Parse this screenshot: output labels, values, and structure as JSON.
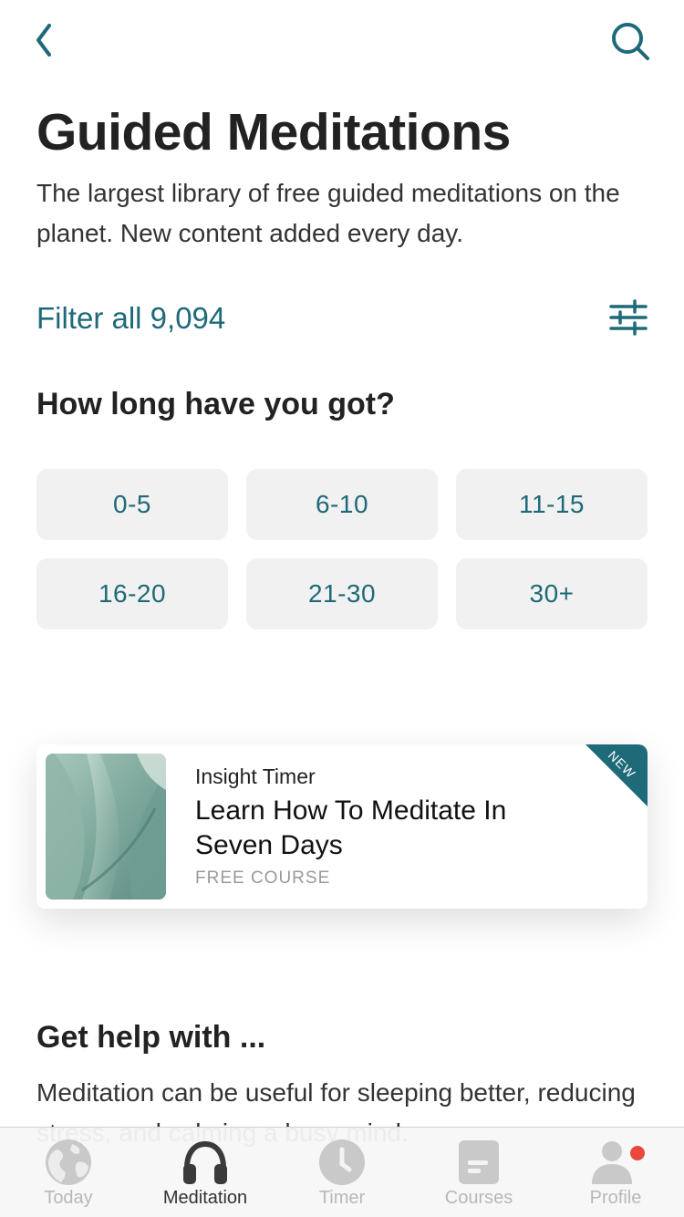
{
  "page": {
    "title": "Guided Meditations",
    "description": "The largest library of free guided meditations on the planet. New content added every day."
  },
  "filter": {
    "label": "Filter all 9,094",
    "icon": "sliders-icon"
  },
  "duration": {
    "heading": "How long have you got?",
    "options": [
      "0-5",
      "6-10",
      "11-15",
      "16-20",
      "21-30",
      "30+"
    ]
  },
  "featured": {
    "author": "Insight Timer",
    "title": "Learn How To Meditate In Seven Days",
    "type": "FREE COURSE",
    "badge": "NEW"
  },
  "help": {
    "heading": "Get help with ...",
    "description": "Meditation can be useful for sleeping better, reducing stress, and calming a busy mind."
  },
  "tabs": [
    {
      "label": "Today",
      "icon": "globe-icon",
      "active": false
    },
    {
      "label": "Meditation",
      "icon": "headphones-icon",
      "active": true
    },
    {
      "label": "Timer",
      "icon": "clock-icon",
      "active": false
    },
    {
      "label": "Courses",
      "icon": "courses-icon",
      "active": false
    },
    {
      "label": "Profile",
      "icon": "profile-icon",
      "active": false
    }
  ],
  "colors": {
    "accent": "#1e6a78",
    "chip_bg": "#f1f1f1",
    "notification": "#e8483f"
  }
}
